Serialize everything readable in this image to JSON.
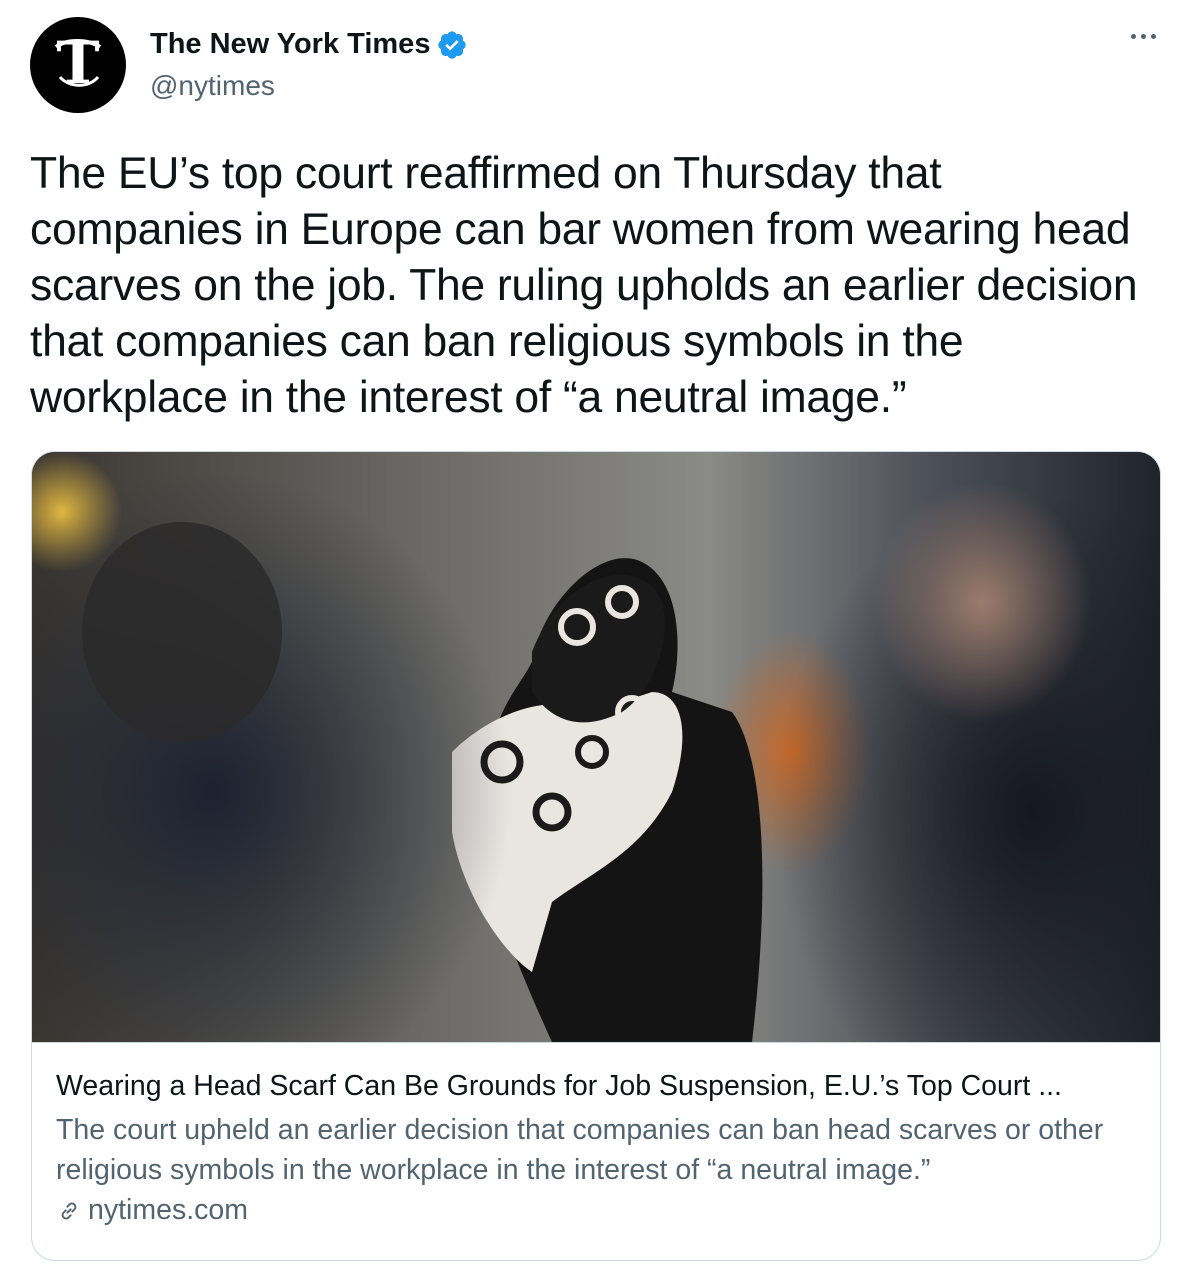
{
  "account": {
    "display_name": "The New York Times",
    "handle": "@nytimes",
    "avatar_icon": "nyt-logo-icon",
    "verified_icon": "verified-badge-icon",
    "verified_color": "#1d9bf0"
  },
  "tweet": {
    "text": "The EU’s top court reaffirmed on Thursday that companies in Europe can bar women from wearing head scarves on the job. The ruling upholds an earlier decision that companies can ban religious symbols in the workplace in the interest of “a neutral image.”"
  },
  "card": {
    "title": "Wearing a Head Scarf Can Be Grounds for Job Suspension, E.U.’s Top Court ...",
    "description": "The court upheld an earlier decision that companies can ban head scarves or other religious symbols in the workplace in the interest of “a neutral image.”",
    "domain": "nytimes.com",
    "link_icon": "link-icon"
  },
  "menu_icon": "more-options-icon"
}
